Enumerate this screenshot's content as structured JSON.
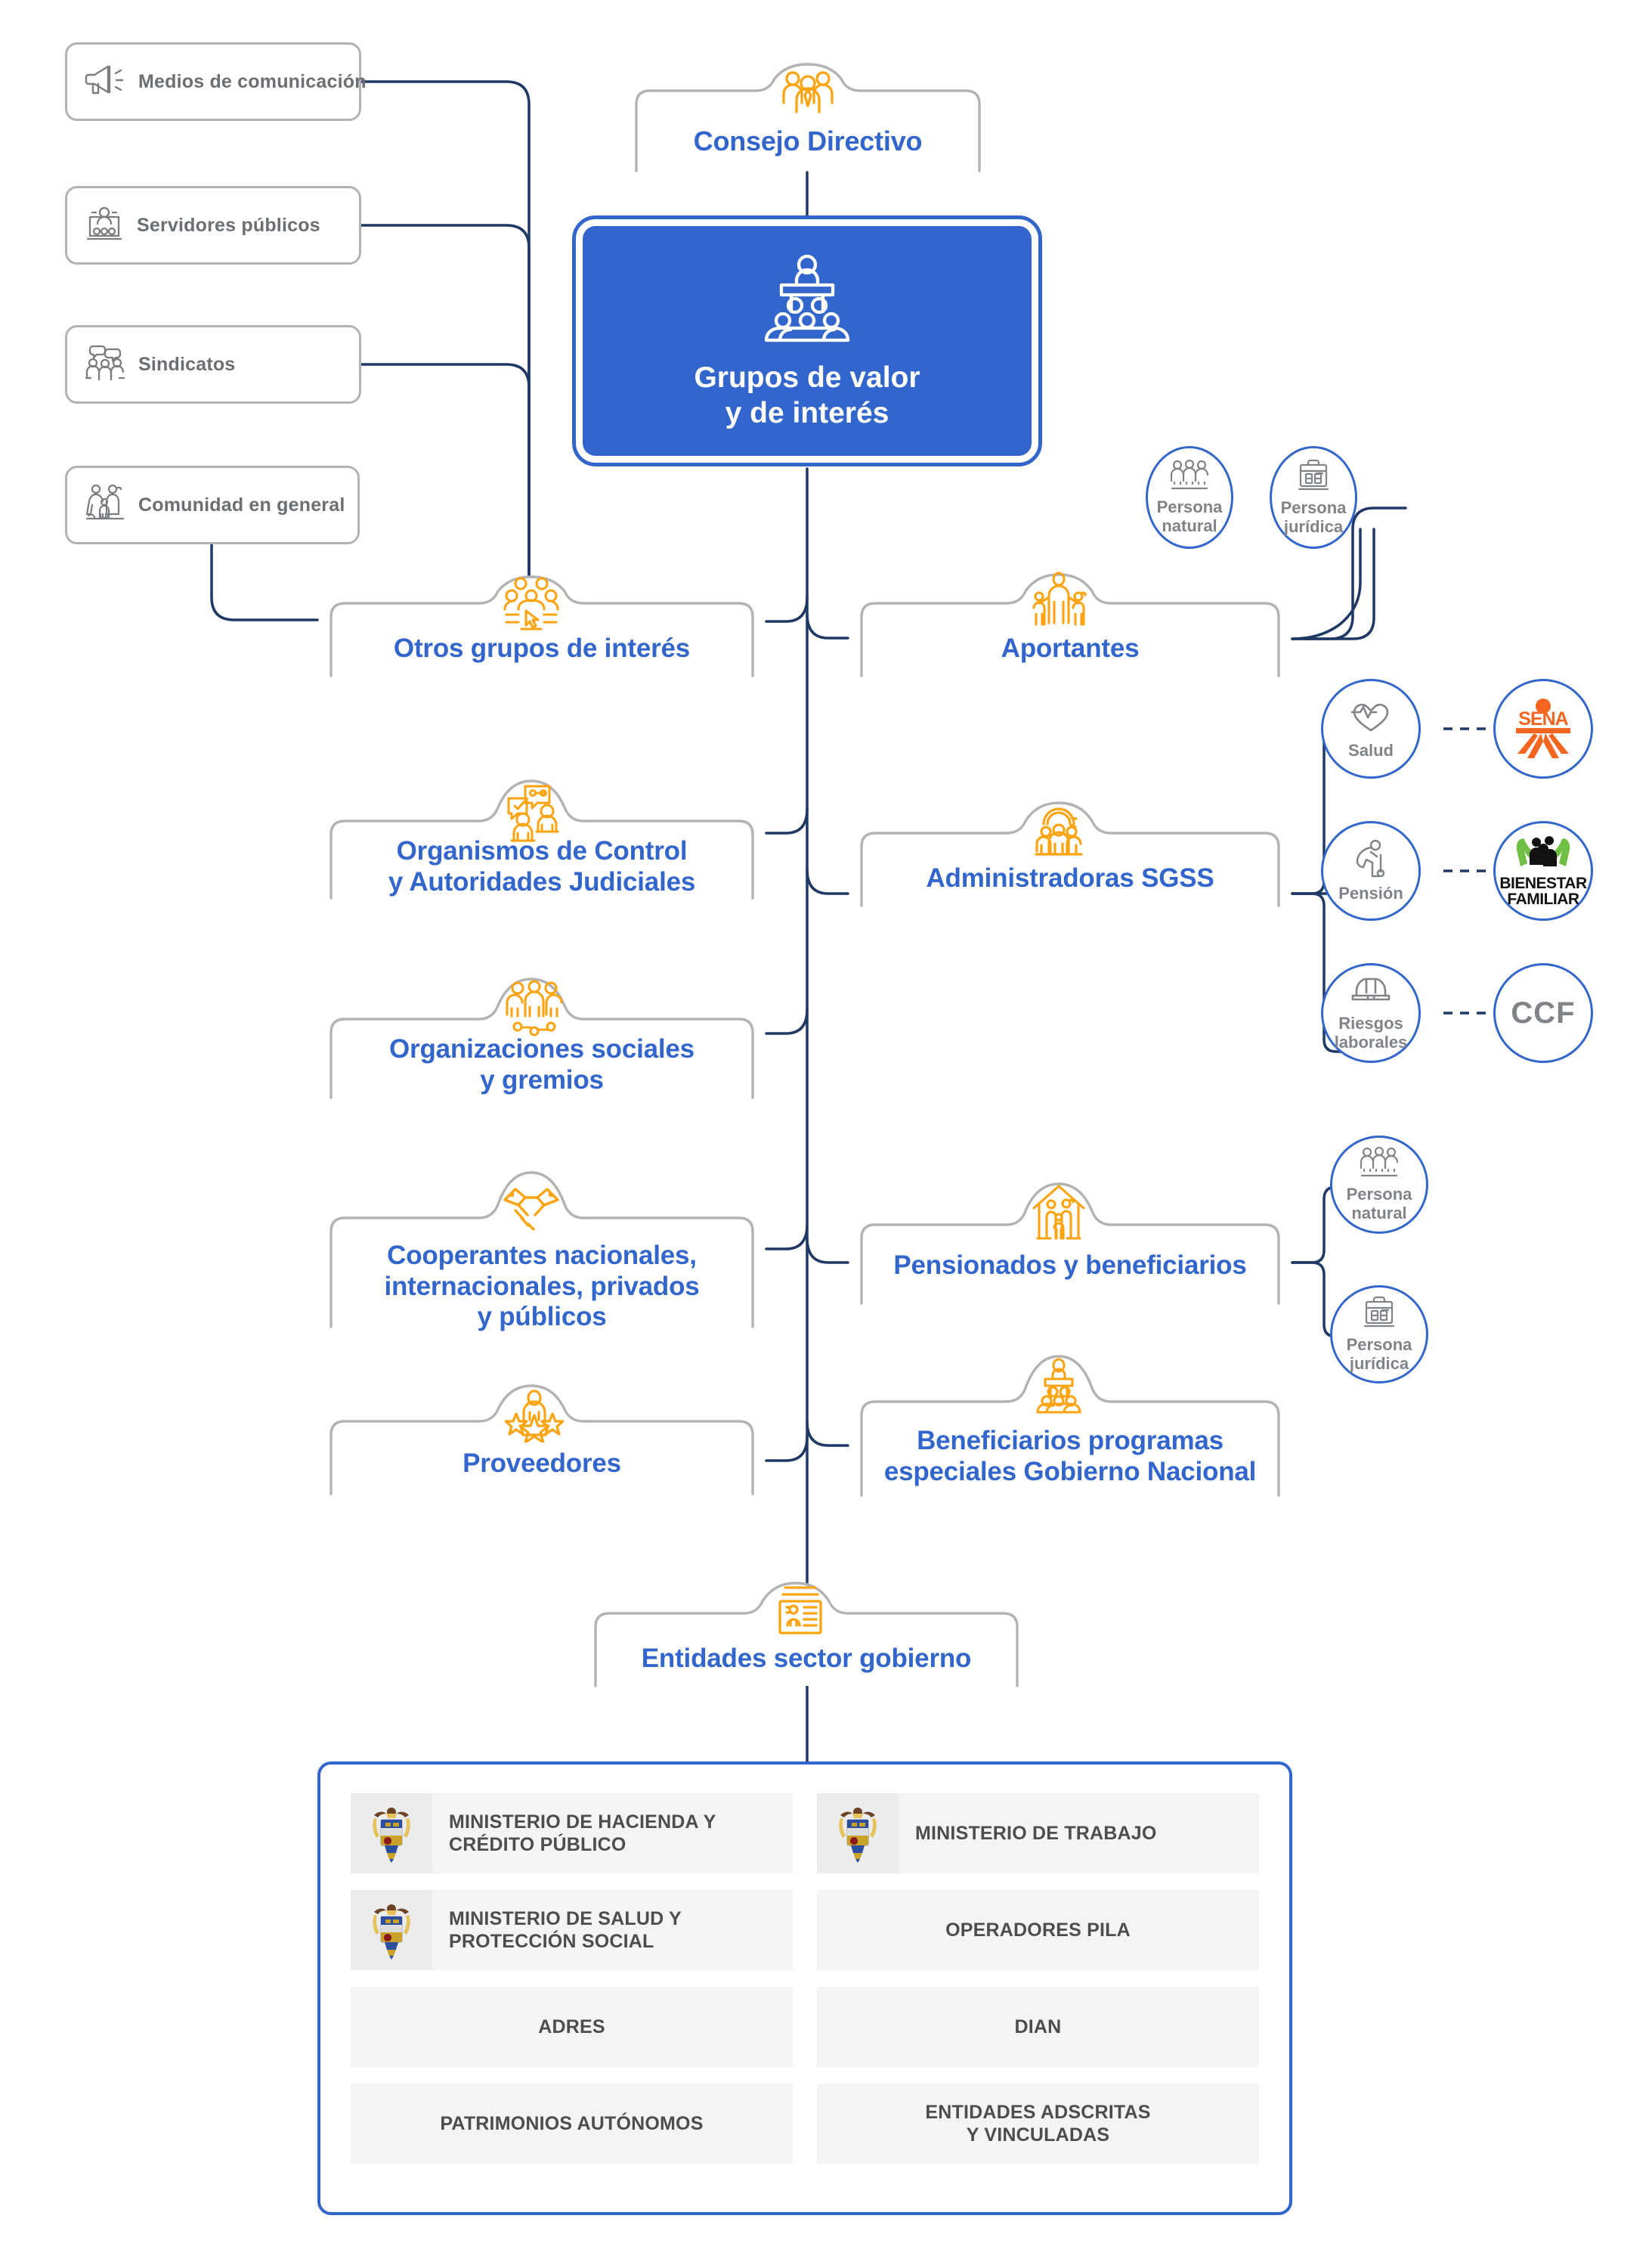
{
  "colors": {
    "brand_blue": "#3366cc",
    "wire_navy": "#1f3864",
    "card_grey_border": "#b3b3b3",
    "icon_orange": "#fca311",
    "label_grey": "#6b6f73",
    "gov_cell_bg": "#f4f4f4",
    "sena_orange": "#f4651f",
    "icbf_green": "#70bf44"
  },
  "hero": {
    "line1": "Grupos de valor",
    "line2": "y de interés",
    "icon": "podium-audience-icon"
  },
  "top_node": {
    "label": "Consejo Directivo",
    "icon": "people-group-icon"
  },
  "side_cards": [
    {
      "label": "Medios de comunicación",
      "icon": "megaphone-icon"
    },
    {
      "label": "Servidores públicos",
      "icon": "public-servant-icon"
    },
    {
      "label": "Sindicatos",
      "icon": "union-speech-icon"
    },
    {
      "label": "Comunidad en general",
      "icon": "community-family-icon"
    }
  ],
  "left_nodes": [
    {
      "label_lines": [
        "Otros grupos de interés"
      ],
      "icon": "audience-cursor-icon"
    },
    {
      "label_lines": [
        "Organismos de Control",
        "y Autoridades Judiciales"
      ],
      "icon": "control-authorities-icon"
    },
    {
      "label_lines": [
        "Organizaciones sociales",
        "y gremios"
      ],
      "icon": "social-orgs-icon"
    },
    {
      "label_lines": [
        "Cooperantes nacionales,",
        "internacionales, privados",
        "y públicos"
      ],
      "icon": "handshake-icon"
    },
    {
      "label_lines": [
        "Proveedores"
      ],
      "icon": "supplier-stars-icon"
    }
  ],
  "right_nodes": [
    {
      "label_lines": [
        "Aportantes"
      ],
      "icon": "family-contributors-icon"
    },
    {
      "label_lines": [
        "Administradoras SGSS"
      ],
      "icon": "sgss-admin-icon"
    },
    {
      "label_lines": [
        "Pensionados y beneficiarios"
      ],
      "icon": "house-family-icon"
    },
    {
      "label_lines": [
        "Beneficiarios programas",
        "especiales Gobierno Nacional"
      ],
      "icon": "podium-audience-icon"
    }
  ],
  "bottom_node": {
    "label": "Entidades sector gobierno",
    "icon": "id-document-icon"
  },
  "aportantes_circles": [
    {
      "lines": [
        "Persona",
        "natural"
      ],
      "icon": "three-people-icon"
    },
    {
      "lines": [
        "Persona",
        "jurídica"
      ],
      "icon": "briefcase-icon"
    }
  ],
  "pensionados_circles": [
    {
      "lines": [
        "Persona",
        "natural"
      ],
      "icon": "three-people-icon"
    },
    {
      "lines": [
        "Persona",
        "jurídica"
      ],
      "icon": "briefcase-icon"
    }
  ],
  "sgss_circles": [
    {
      "lines": [
        "Salud"
      ],
      "icon": "heart-pulse-icon"
    },
    {
      "lines": [
        "Pensión"
      ],
      "icon": "elderly-person-icon"
    },
    {
      "lines": [
        "Riesgos",
        "laborales"
      ],
      "icon": "hard-hat-icon"
    }
  ],
  "sgss_logo_circles": [
    {
      "kind": "sena",
      "text": "SENA"
    },
    {
      "kind": "icbf",
      "text_line1": "BIENESTAR",
      "text_line2": "FAMILIAR"
    },
    {
      "kind": "text",
      "text": "CCF"
    }
  ],
  "government_panel": {
    "cells": [
      {
        "label": "MINISTERIO DE HACIENDA Y\nCRÉDITO PÚBLICO",
        "has_logo": true,
        "logo": "colombia-coat-of-arms"
      },
      {
        "label": "MINISTERIO DE TRABAJO",
        "has_logo": true,
        "logo": "colombia-coat-of-arms"
      },
      {
        "label": "MINISTERIO DE SALUD Y\nPROTECCIÓN SOCIAL",
        "has_logo": true,
        "logo": "colombia-coat-of-arms"
      },
      {
        "label": "OPERADORES PILA",
        "has_logo": false
      },
      {
        "label": "ADRES",
        "has_logo": false
      },
      {
        "label": "DIAN",
        "has_logo": false
      },
      {
        "label": "PATRIMONIOS AUTÓNOMOS",
        "has_logo": false
      },
      {
        "label": "ENTIDADES ADSCRITAS\nY VINCULADAS",
        "has_logo": false
      }
    ]
  }
}
